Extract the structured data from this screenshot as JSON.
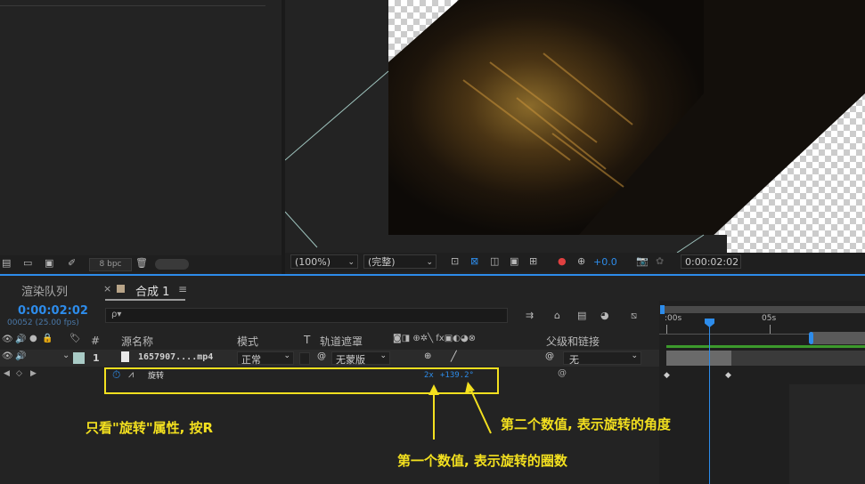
{
  "left_panel": {
    "bpc_label": "8 bpc"
  },
  "viewer_bar": {
    "zoom": "(100%)",
    "resolution": "(完整)",
    "exposure": "+0.0",
    "timecode": "0:00:02:02"
  },
  "tabs": {
    "render_queue": "渲染队列",
    "comp_close": "×",
    "comp_name": "合成 1",
    "menu_icon": "≡"
  },
  "timeline": {
    "current_time": "0:00:02:02",
    "frame_info": "00052 (25.00 fps)",
    "search_placeholder": "ρ▾",
    "ruler_start": ":00s",
    "ruler_mark": "05s"
  },
  "columns": {
    "hash": "#",
    "source_name": "源名称",
    "mode": "模式",
    "t": "T",
    "track_matte": "轨道遮罩",
    "parent_link": "父级和链接"
  },
  "layer": {
    "index": "1",
    "name": "1657907....mp4",
    "mode": "正常",
    "matte": "无蒙版",
    "parent": "无"
  },
  "property": {
    "name": "旋转",
    "value_revolutions": "2x",
    "value_angle": "+139.2°"
  },
  "annotations": {
    "note_r": "只看\"旋转\"属性, 按R",
    "note_angle": "第二个数值, 表示旋转的角度",
    "note_revolutions": "第一个数值, 表示旋转的圈数"
  },
  "colors": {
    "accent": "#2d8ceb",
    "annotation": "#f3e01f",
    "label_swatch": "#a9cbc6"
  }
}
